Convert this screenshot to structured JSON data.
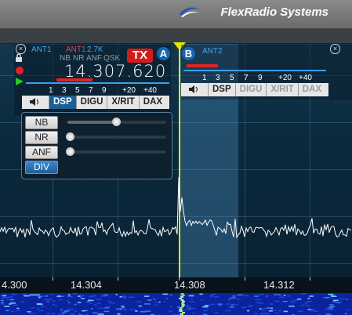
{
  "brand": {
    "name": "FlexRadio Systems"
  },
  "slice_a": {
    "rx_ant": "ANT1",
    "tx_ant": "ANT1",
    "filter_width": "2.7K",
    "dsp_flags": [
      "NB",
      "NR",
      "ANF",
      "QSK"
    ],
    "frequency": "14.307.620",
    "tx_badge": "TX",
    "letter": "A",
    "s_meter_scale": [
      "1",
      "3",
      "5",
      "7",
      "9",
      "+20",
      "+40"
    ],
    "tabs": [
      "DSP",
      "DIGU",
      "X/RIT",
      "DAX"
    ],
    "active_tab": "DSP"
  },
  "slice_b": {
    "letter": "B",
    "rx_ant": "ANT2",
    "s_meter_scale": [
      "1",
      "3",
      "5",
      "7",
      "9",
      "+20",
      "+40"
    ],
    "tabs": [
      "DSP",
      "DIGU",
      "X/RIT",
      "DAX"
    ]
  },
  "dsp_panel": {
    "rows": [
      {
        "label": "NB",
        "level": 0.5,
        "active": false
      },
      {
        "label": "NR",
        "level": 0.0,
        "active": false
      },
      {
        "label": "ANF",
        "level": 0.0,
        "active": false
      },
      {
        "label": "DIV",
        "active": true
      }
    ]
  },
  "freq_axis": {
    "labels": [
      "4.300",
      "14.304",
      "14.308",
      "14.312"
    ]
  },
  "colors": {
    "accent_blue": "#1a5f97",
    "tx_red": "#d21b1b",
    "cursor_yellow": "#e6e600",
    "waterfall_blue": "#0c23a0"
  }
}
